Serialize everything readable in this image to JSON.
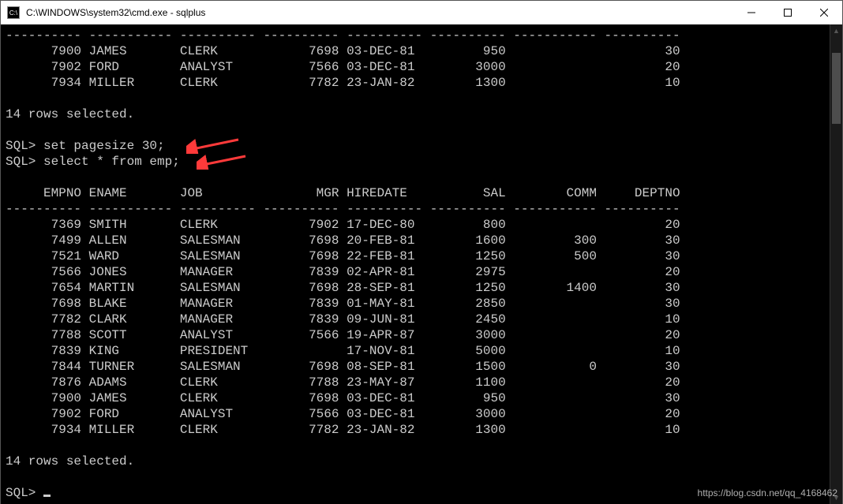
{
  "window": {
    "title": "C:\\WINDOWS\\system32\\cmd.exe - sqlplus"
  },
  "top_rows": [
    {
      "empno": "7900",
      "ename": "JAMES",
      "job": "CLERK",
      "mgr": "7698",
      "hiredate": "03-DEC-81",
      "sal": "950",
      "comm": "",
      "deptno": "30"
    },
    {
      "empno": "7902",
      "ename": "FORD",
      "job": "ANALYST",
      "mgr": "7566",
      "hiredate": "03-DEC-81",
      "sal": "3000",
      "comm": "",
      "deptno": "20"
    },
    {
      "empno": "7934",
      "ename": "MILLER",
      "job": "CLERK",
      "mgr": "7782",
      "hiredate": "23-JAN-82",
      "sal": "1300",
      "comm": "",
      "deptno": "10"
    }
  ],
  "rows_selected_msg": "14 rows selected.",
  "prompts": {
    "sql": "SQL>",
    "cmd1": "set pagesize 30;",
    "cmd2": "select * from emp;"
  },
  "headers": {
    "empno": "EMPNO",
    "ename": "ENAME",
    "job": "JOB",
    "mgr": "MGR",
    "hiredate": "HIREDATE",
    "sal": "SAL",
    "comm": "COMM",
    "deptno": "DEPTNO"
  },
  "emp_rows": [
    {
      "empno": "7369",
      "ename": "SMITH",
      "job": "CLERK",
      "mgr": "7902",
      "hiredate": "17-DEC-80",
      "sal": "800",
      "comm": "",
      "deptno": "20"
    },
    {
      "empno": "7499",
      "ename": "ALLEN",
      "job": "SALESMAN",
      "mgr": "7698",
      "hiredate": "20-FEB-81",
      "sal": "1600",
      "comm": "300",
      "deptno": "30"
    },
    {
      "empno": "7521",
      "ename": "WARD",
      "job": "SALESMAN",
      "mgr": "7698",
      "hiredate": "22-FEB-81",
      "sal": "1250",
      "comm": "500",
      "deptno": "30"
    },
    {
      "empno": "7566",
      "ename": "JONES",
      "job": "MANAGER",
      "mgr": "7839",
      "hiredate": "02-APR-81",
      "sal": "2975",
      "comm": "",
      "deptno": "20"
    },
    {
      "empno": "7654",
      "ename": "MARTIN",
      "job": "SALESMAN",
      "mgr": "7698",
      "hiredate": "28-SEP-81",
      "sal": "1250",
      "comm": "1400",
      "deptno": "30"
    },
    {
      "empno": "7698",
      "ename": "BLAKE",
      "job": "MANAGER",
      "mgr": "7839",
      "hiredate": "01-MAY-81",
      "sal": "2850",
      "comm": "",
      "deptno": "30"
    },
    {
      "empno": "7782",
      "ename": "CLARK",
      "job": "MANAGER",
      "mgr": "7839",
      "hiredate": "09-JUN-81",
      "sal": "2450",
      "comm": "",
      "deptno": "10"
    },
    {
      "empno": "7788",
      "ename": "SCOTT",
      "job": "ANALYST",
      "mgr": "7566",
      "hiredate": "19-APR-87",
      "sal": "3000",
      "comm": "",
      "deptno": "20"
    },
    {
      "empno": "7839",
      "ename": "KING",
      "job": "PRESIDENT",
      "mgr": "",
      "hiredate": "17-NOV-81",
      "sal": "5000",
      "comm": "",
      "deptno": "10"
    },
    {
      "empno": "7844",
      "ename": "TURNER",
      "job": "SALESMAN",
      "mgr": "7698",
      "hiredate": "08-SEP-81",
      "sal": "1500",
      "comm": "0",
      "deptno": "30"
    },
    {
      "empno": "7876",
      "ename": "ADAMS",
      "job": "CLERK",
      "mgr": "7788",
      "hiredate": "23-MAY-87",
      "sal": "1100",
      "comm": "",
      "deptno": "20"
    },
    {
      "empno": "7900",
      "ename": "JAMES",
      "job": "CLERK",
      "mgr": "7698",
      "hiredate": "03-DEC-81",
      "sal": "950",
      "comm": "",
      "deptno": "30"
    },
    {
      "empno": "7902",
      "ename": "FORD",
      "job": "ANALYST",
      "mgr": "7566",
      "hiredate": "03-DEC-81",
      "sal": "3000",
      "comm": "",
      "deptno": "20"
    },
    {
      "empno": "7934",
      "ename": "MILLER",
      "job": "CLERK",
      "mgr": "7782",
      "hiredate": "23-JAN-82",
      "sal": "1300",
      "comm": "",
      "deptno": "10"
    }
  ],
  "watermark": "https://blog.csdn.net/qq_4168462",
  "col_widths": {
    "empno": 10,
    "ename": 11,
    "job": 10,
    "mgr": 10,
    "hiredate": 10,
    "sal": 10,
    "comm": 11,
    "deptno": 10
  },
  "annotation": {
    "arrow_color": "#ff3a3a"
  }
}
